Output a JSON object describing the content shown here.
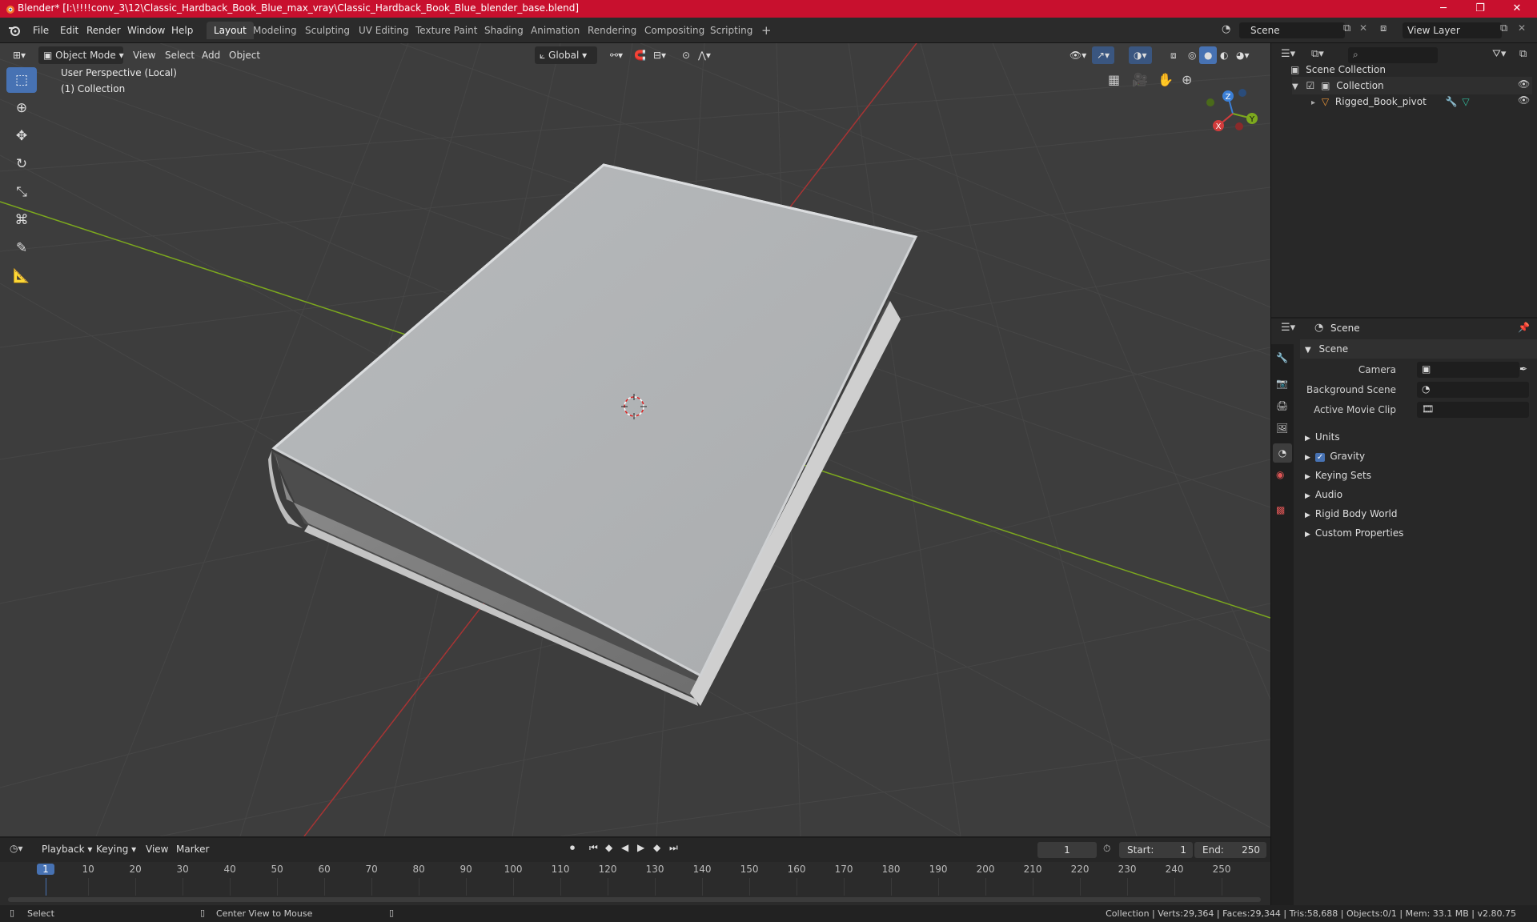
{
  "window": {
    "title": "Blender* [I:\\!!!!conv_3\\12\\Classic_Hardback_Book_Blue_max_vray\\Classic_Hardback_Book_Blue_blender_base.blend]",
    "minimize": "─",
    "maximize": "❐",
    "close": "✕"
  },
  "menu": [
    "File",
    "Edit",
    "Render",
    "Window",
    "Help"
  ],
  "workspaces": [
    "Layout",
    "Modeling",
    "Sculpting",
    "UV Editing",
    "Texture Paint",
    "Shading",
    "Animation",
    "Rendering",
    "Compositing",
    "Scripting"
  ],
  "workspace_add": "+",
  "scene_field": "Scene",
  "view_layer_field": "View Layer",
  "viewport": {
    "mode": "Object Mode",
    "menus": [
      "View",
      "Select",
      "Add",
      "Object"
    ],
    "orientation": "Global",
    "info_line1": "User Perspective (Local)",
    "info_line2": "(1) Collection",
    "gizmo": {
      "x": "X",
      "y": "Y",
      "z": "Z"
    }
  },
  "outliner": {
    "search_placeholder": "",
    "root": "Scene Collection",
    "collection": "Collection",
    "object": "Rigged_Book_pivot"
  },
  "properties": {
    "header": "Scene",
    "section": "Scene",
    "camera_label": "Camera",
    "background_label": "Background Scene",
    "movie_label": "Active Movie Clip",
    "panels": [
      "Units",
      "Gravity",
      "Keying Sets",
      "Audio",
      "Rigid Body World",
      "Custom Properties"
    ]
  },
  "timeline": {
    "menus": [
      "Playback",
      "Keying",
      "View",
      "Marker"
    ],
    "current_frame": "1",
    "start_label": "Start:",
    "start_value": "1",
    "end_label": "End:",
    "end_value": "250",
    "ruler": [
      "1",
      "10",
      "20",
      "30",
      "40",
      "50",
      "60",
      "70",
      "80",
      "90",
      "100",
      "110",
      "120",
      "130",
      "140",
      "150",
      "160",
      "170",
      "180",
      "190",
      "200",
      "210",
      "220",
      "230",
      "240",
      "250"
    ]
  },
  "status": {
    "select": "Select",
    "center": "Center View to Mouse",
    "stats": "Collection | Verts:29,364 | Faces:29,344 | Tris:58,688 | Objects:0/1 | Mem: 33.1 MB | v2.80.75"
  },
  "colors": {
    "title_bar": "#c8102e",
    "accent": "#4772b3",
    "x_axis": "#d23c3c",
    "y_axis": "#7ca81e",
    "z_axis": "#3b7fd6"
  }
}
